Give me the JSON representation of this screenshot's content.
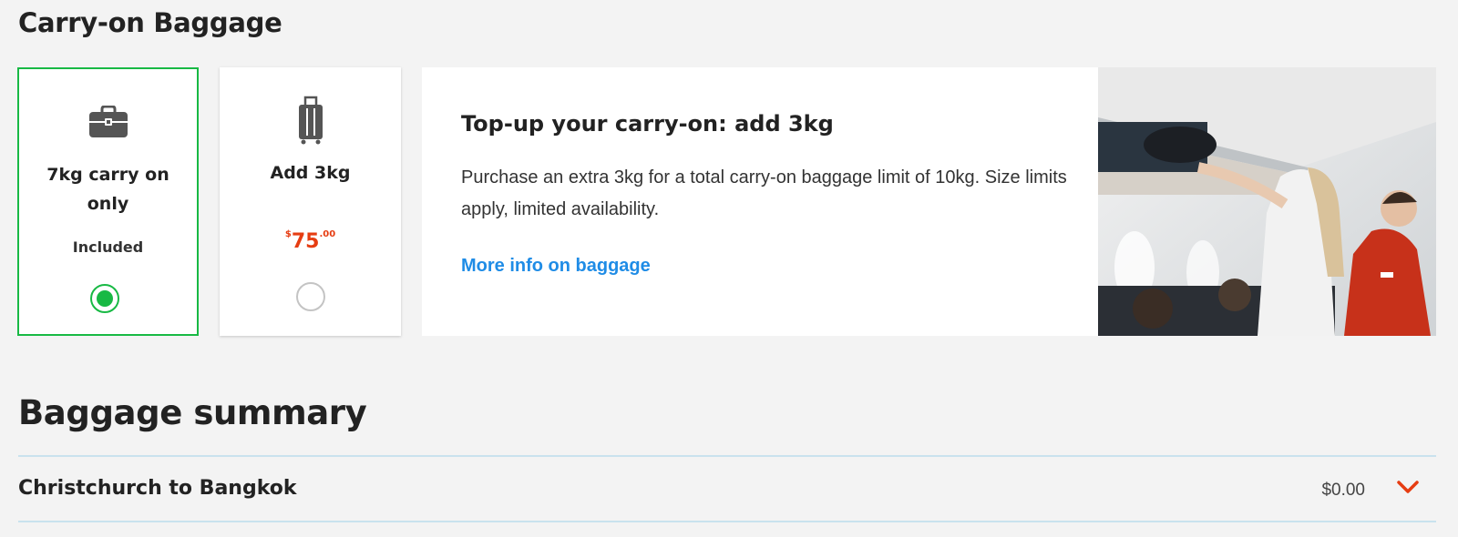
{
  "carry_on": {
    "section_title": "Carry-on Baggage",
    "options": [
      {
        "icon": "briefcase-icon",
        "label": "7kg carry on only",
        "status": "Included",
        "selected": true
      },
      {
        "icon": "rolling-suitcase-icon",
        "label": "Add 3kg",
        "price": {
          "currency": "$",
          "main": "75",
          "cents": ".00"
        },
        "selected": false
      }
    ],
    "info": {
      "title": "Top-up your carry-on: add 3kg",
      "description": "Purchase an extra 3kg for a total carry-on baggage limit of 10kg. Size limits apply, limited availability.",
      "link": "More info on baggage"
    }
  },
  "summary": {
    "title": "Baggage summary",
    "rows": [
      {
        "route": "Christchurch to Bangkok",
        "price": "$0.00",
        "icon": "chevron-down-icon"
      }
    ]
  },
  "colors": {
    "selected_green": "#18b944",
    "price_orange": "#e63d12",
    "link_blue": "#1f8ce6",
    "divider_blue": "#c9e2ee"
  }
}
